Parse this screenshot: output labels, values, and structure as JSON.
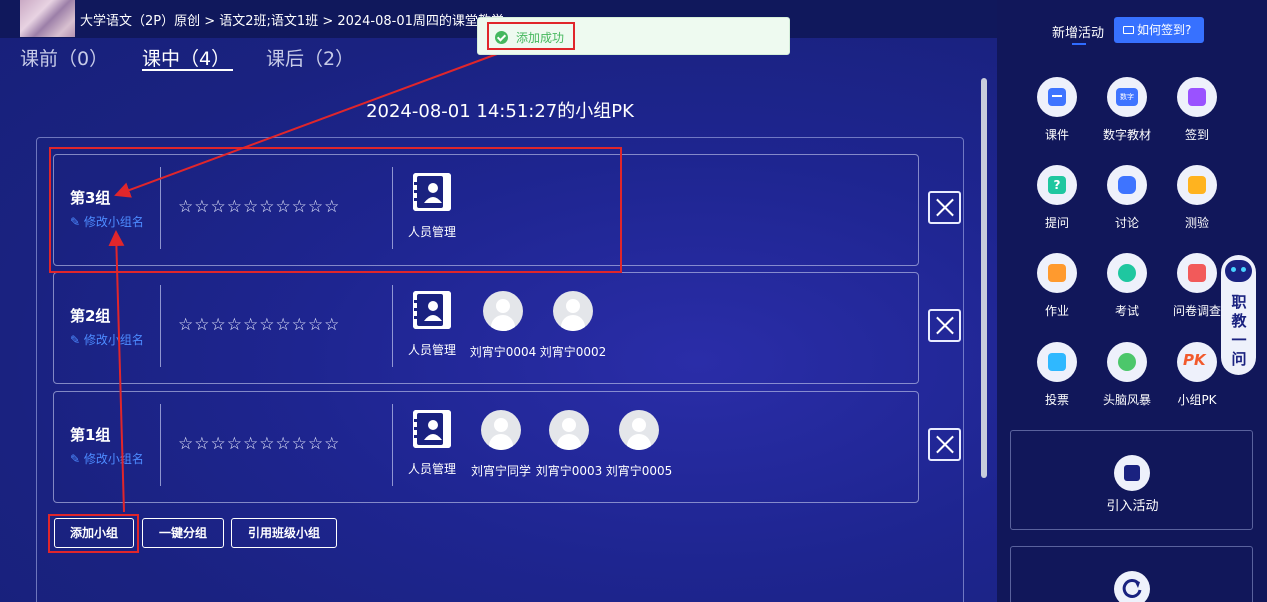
{
  "breadcrumb": "大学语文（2P）原创 > 语文2班;语文1班 > 2024-08-01周四的课堂教学",
  "tabs": [
    {
      "label": "课前（0）"
    },
    {
      "label": "课中（4）"
    },
    {
      "label": "课后（2）"
    }
  ],
  "session_title": "2024-08-01 14:51:27的小组PK",
  "toast": {
    "text": "添加成功"
  },
  "edit_label": "修改小组名",
  "stars": "☆☆☆☆☆☆☆☆☆☆",
  "groups": [
    {
      "name": "第3组",
      "members": [
        {
          "label": "人员管理"
        }
      ]
    },
    {
      "name": "第2组",
      "members": [
        {
          "label": "人员管理"
        },
        {
          "label": "刘宵宁0004"
        },
        {
          "label": "刘宵宁0002"
        }
      ]
    },
    {
      "name": "第1组",
      "members": [
        {
          "label": "人员管理"
        },
        {
          "label": "刘宵宁同学"
        },
        {
          "label": "刘宵宁0003"
        },
        {
          "label": "刘宵宁0005"
        }
      ]
    }
  ],
  "actions": {
    "add_group": "添加小组",
    "auto_group": "一键分组",
    "import_group": "引用班级小组"
  },
  "side": {
    "title": "新增活动",
    "how_btn": "如何签到?",
    "tools": [
      {
        "label": "课件",
        "color": "#3e74ff"
      },
      {
        "label": "数字教材",
        "color": "#3e74ff"
      },
      {
        "label": "签到",
        "color": "#9a52ff"
      },
      {
        "label": "提问",
        "color": "#1fc7a0"
      },
      {
        "label": "讨论",
        "color": "#3e74ff"
      },
      {
        "label": "测验",
        "color": "#ffb31f"
      },
      {
        "label": "作业",
        "color": "#ff9a2e"
      },
      {
        "label": "考试",
        "color": "#1fc7a0"
      },
      {
        "label": "问卷调查",
        "color": "#f25a5a"
      },
      {
        "label": "投票",
        "color": "#2fb8ff"
      },
      {
        "label": "头脑风暴",
        "color": "#4cc76b"
      },
      {
        "label": "小组PK",
        "color": "#f25a2c"
      }
    ],
    "import_activity": "引入活动",
    "digital_icon_text": "数字",
    "pk_icon_text": "PK"
  },
  "robot_text": "职教一问"
}
